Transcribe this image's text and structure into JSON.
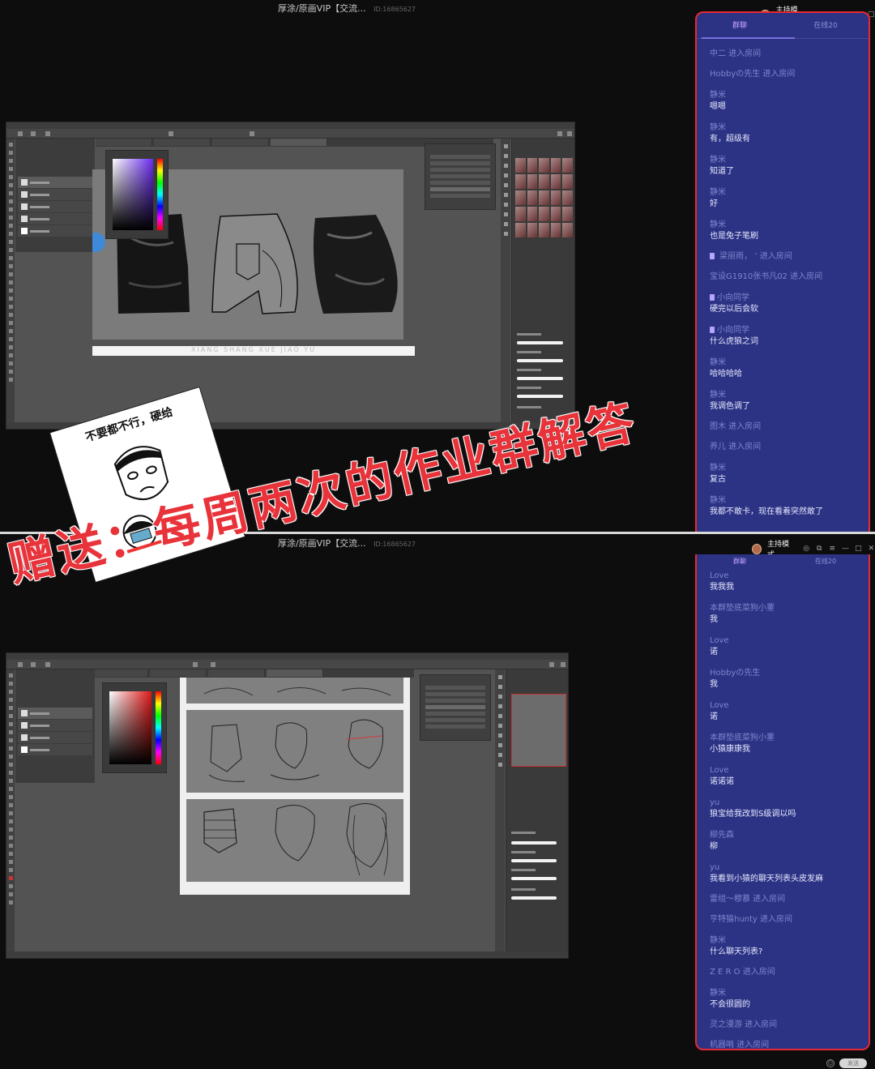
{
  "window": {
    "title": "厚涂/原画VIP【交流...",
    "room_id": "ID:16865627"
  },
  "controls": {
    "mode_label": "主持模式"
  },
  "top_chat": {
    "tabs": [
      {
        "label": "群聊",
        "active": true
      },
      {
        "label": "在线20",
        "active": false
      }
    ],
    "messages": [
      {
        "name": "中二 进入房间",
        "text": "",
        "system": true
      },
      {
        "name": "Hobbyの先生 进入房间",
        "text": "",
        "system": true
      },
      {
        "name": "静米",
        "text": "嗯嗯"
      },
      {
        "name": "静米",
        "text": "有，超级有"
      },
      {
        "name": "静米",
        "text": "知道了"
      },
      {
        "name": "静米",
        "text": "好"
      },
      {
        "name": "静米",
        "text": "也是兔子笔刷"
      },
      {
        "name": "     梁丽雨， ’  进入房间",
        "text": "",
        "system": true,
        "badge": true
      },
      {
        "name": "宝设G1910张书凡02 进入房间",
        "text": "",
        "system": true
      },
      {
        "name": "小向同学",
        "text": "硬完以后会软",
        "badge": true
      },
      {
        "name": "小向同学",
        "text": "什么虎狼之词",
        "badge": true
      },
      {
        "name": "静米",
        "text": "哈哈哈哈"
      },
      {
        "name": "静米",
        "text": "我调色调了"
      },
      {
        "name": "图木 进入房间",
        "text": "",
        "system": true
      },
      {
        "name": "养儿 进入房间",
        "text": "",
        "system": true
      },
      {
        "name": "静米",
        "text": "复古"
      },
      {
        "name": "静米",
        "text": "我都不敢卡，现在看着突然敢了"
      }
    ]
  },
  "bottom_chat": {
    "tabs": [
      {
        "label": "群聊",
        "active": true
      },
      {
        "label": "在线20",
        "active": false
      }
    ],
    "messages": [
      {
        "name": "Love",
        "text": "我我我"
      },
      {
        "name": "本群垫底菜狗小董",
        "text": "我"
      },
      {
        "name": "Love",
        "text": "诺"
      },
      {
        "name": "Hobbyの先生",
        "text": "我"
      },
      {
        "name": "Love",
        "text": "诺"
      },
      {
        "name": "本群垫底菜狗小董",
        "text": "小猿康康我"
      },
      {
        "name": "Love",
        "text": "诺诺诺"
      },
      {
        "name": "yu",
        "text": "狼宝给我改到S级调以吗"
      },
      {
        "name": "柳先森",
        "text": "柳"
      },
      {
        "name": "yu",
        "text": "我看到小猿的聊天列表头皮发麻"
      },
      {
        "name": "雷组～穆慕 进入房间",
        "text": "",
        "system": true
      },
      {
        "name": "亨特猫hunty 进入房间",
        "text": "",
        "system": true
      },
      {
        "name": "静米",
        "text": "什么聊天列表?"
      },
      {
        "name": "Z E R O 进入房间",
        "text": "",
        "system": true
      },
      {
        "name": "静米",
        "text": "不会很圆的"
      },
      {
        "name": "灵之漫游 进入房间",
        "text": "",
        "system": true
      },
      {
        "name": "机器哨 进入房间",
        "text": "",
        "system": true
      }
    ],
    "send_label": "发送"
  },
  "top_canvas_watermark": "XIANG SHANG XUE JIAO YU",
  "overlay": {
    "meme_caption": "不要都不行，硬给",
    "promo_text": "赠送：每周两次的作业群解答"
  },
  "colors": {
    "chat_bg": "#2c3384",
    "highlight_border": "#e52a31",
    "promo_red": "#e8333a",
    "ps_gray": "#535353"
  }
}
